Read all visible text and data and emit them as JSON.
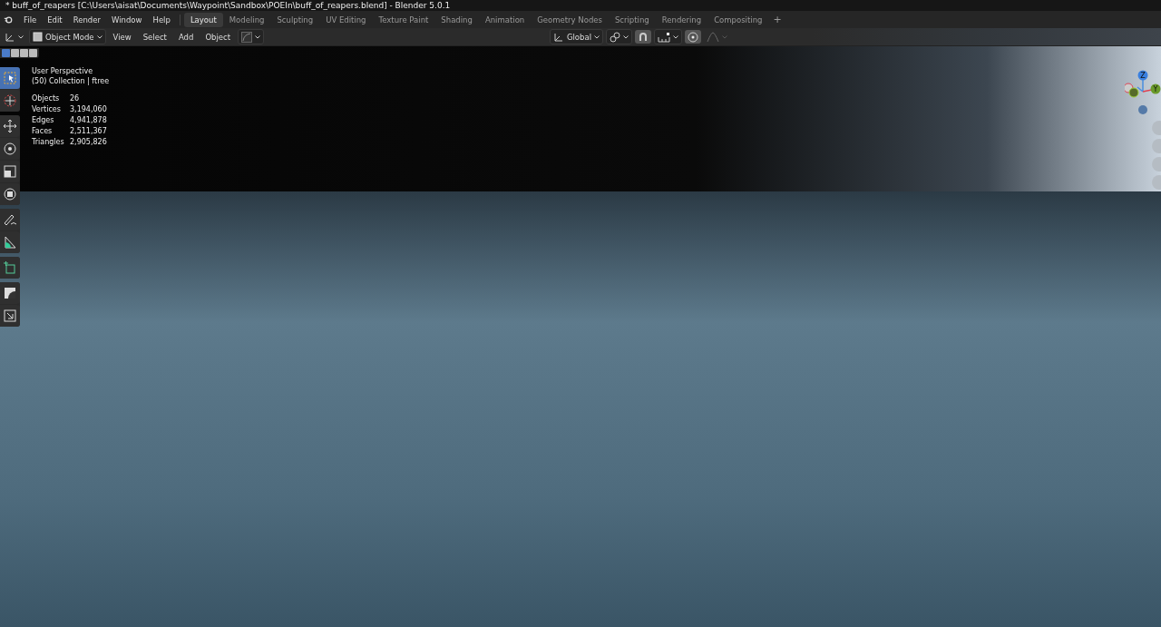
{
  "window": {
    "title": "* buff_of_reapers [C:\\Users\\aisat\\Documents\\Waypoint\\Sandbox\\POEIn\\buff_of_reapers.blend] - Blender 5.0.1"
  },
  "menus": [
    "File",
    "Edit",
    "Render",
    "Window",
    "Help"
  ],
  "workspaces": [
    {
      "label": "Layout",
      "selected": true
    },
    {
      "label": "Modeling",
      "selected": false
    },
    {
      "label": "Sculpting",
      "selected": false
    },
    {
      "label": "UV Editing",
      "selected": false
    },
    {
      "label": "Texture Paint",
      "selected": false
    },
    {
      "label": "Shading",
      "selected": false
    },
    {
      "label": "Animation",
      "selected": false
    },
    {
      "label": "Geometry Nodes",
      "selected": false
    },
    {
      "label": "Scripting",
      "selected": false
    },
    {
      "label": "Rendering",
      "selected": false
    },
    {
      "label": "Compositing",
      "selected": false
    }
  ],
  "add_workspace": "+",
  "header": {
    "mode": "Object Mode",
    "menus": [
      "View",
      "Select",
      "Add",
      "Object"
    ],
    "orientation": "Global"
  },
  "viewport": {
    "view_name": "User Perspective",
    "collection": "(50) Collection | ftree",
    "stats": [
      {
        "label": "Objects",
        "value": "26"
      },
      {
        "label": "Vertices",
        "value": "3,194,060"
      },
      {
        "label": "Edges",
        "value": "4,941,878"
      },
      {
        "label": "Faces",
        "value": "2,511,367"
      },
      {
        "label": "Triangles",
        "value": "2,905,826"
      }
    ],
    "tools": [
      {
        "kind": "select",
        "selected": true
      },
      {
        "kind": "cursor",
        "selected": false
      },
      {
        "kind": "move",
        "selected": false
      },
      {
        "kind": "rotate",
        "selected": false
      },
      {
        "kind": "scale",
        "selected": false
      },
      {
        "kind": "transform",
        "selected": false
      },
      {
        "kind": "annotate",
        "selected": false
      },
      {
        "kind": "measure",
        "selected": false
      },
      {
        "kind": "addcube",
        "selected": false
      },
      {
        "kind": "bevel",
        "selected": false
      },
      {
        "kind": "shrink",
        "selected": false
      }
    ],
    "gizmo": {
      "z": "Z",
      "y": "Y"
    }
  }
}
